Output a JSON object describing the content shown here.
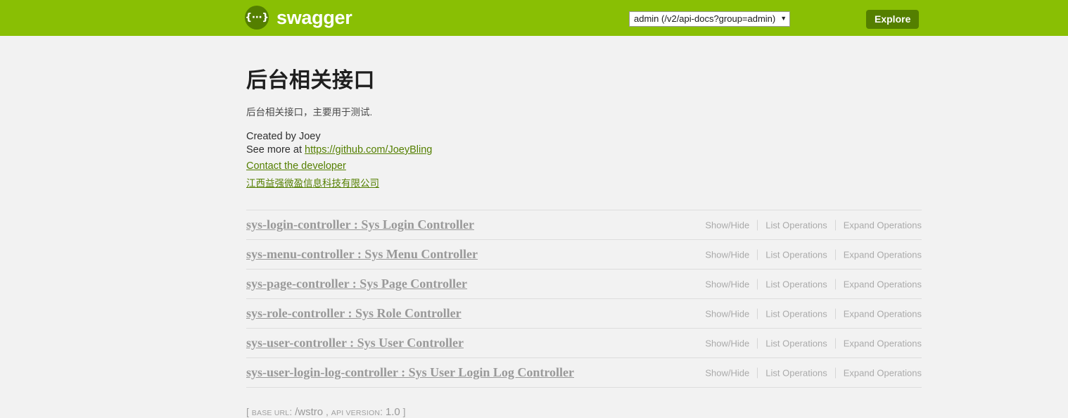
{
  "topbar": {
    "logo_glyph": "{···}",
    "logo_text": "swagger",
    "api_select_value": "admin (/v2/api-docs?group=admin)",
    "api_select_arrow": "▼",
    "explore_label": "Explore"
  },
  "info": {
    "title": "后台相关接口",
    "description": "后台相关接口，主要用于测试.",
    "created_by": "Created by Joey",
    "see_more_prefix": "See more at ",
    "see_more_link": "https://github.com/JoeyBling",
    "contact_link": "Contact the developer",
    "license_link": "江西益强微盈信息科技有限公司"
  },
  "resources": {
    "options": {
      "show_hide": "Show/Hide",
      "list_operations": "List Operations",
      "expand_operations": "Expand Operations"
    },
    "items": [
      {
        "title": "sys-login-controller : Sys Login Controller"
      },
      {
        "title": "sys-menu-controller : Sys Menu Controller"
      },
      {
        "title": "sys-page-controller : Sys Page Controller"
      },
      {
        "title": "sys-role-controller : Sys Role Controller"
      },
      {
        "title": "sys-user-controller : Sys User Controller"
      },
      {
        "title": "sys-user-login-log-controller : Sys User Login Log Controller"
      }
    ]
  },
  "footer": {
    "open_bracket": "[",
    "base_url_label": "BASE URL",
    "base_url_sep": ":",
    "base_url_value": "/wstro",
    "comma": ",",
    "api_version_label": "API VERSION",
    "api_version_sep": ":",
    "api_version_value": "1.0",
    "close_bracket": "]"
  },
  "colors": {
    "header_green": "#89bf04",
    "dark_green": "#547f00",
    "page_background": "#f2f2f2",
    "resource_title": "#999999"
  }
}
